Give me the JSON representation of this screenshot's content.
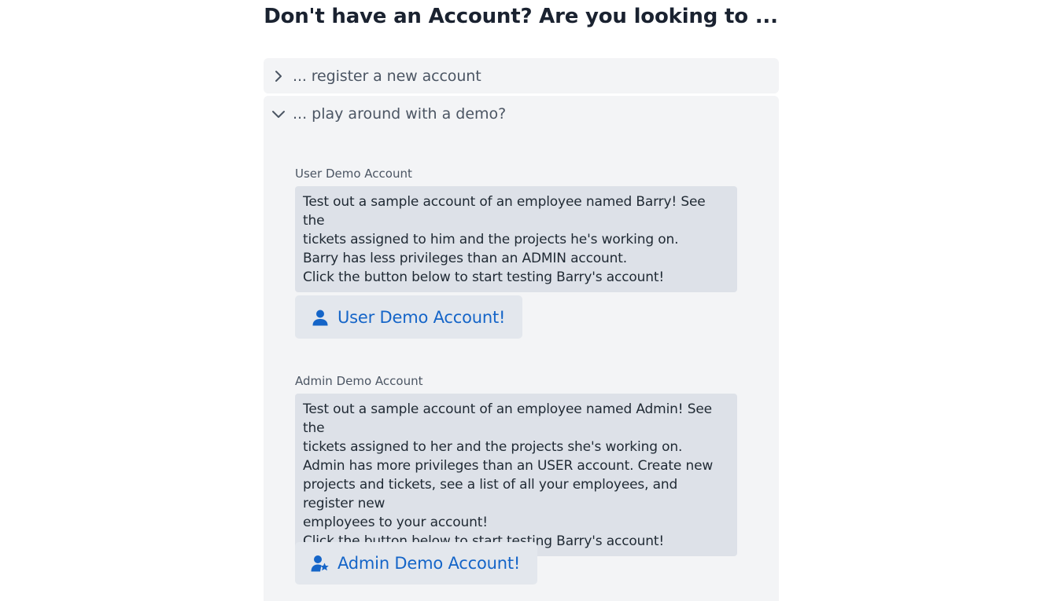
{
  "title": "Don't have an Account? Are you looking to ...",
  "accordion": {
    "register_label": "... register a new account",
    "demo_label": "... play around with a demo?"
  },
  "user_demo": {
    "label": "User Demo Account",
    "lines": [
      "Test out a sample account of an employee named Barry! See the",
      "tickets assigned to him and the projects he's working on.",
      "Barry has less privileges than an ADMIN account.",
      "Click the button below to start testing Barry's account!"
    ],
    "button_label": "User Demo Account!",
    "icon": "user-icon"
  },
  "admin_demo": {
    "label": "Admin Demo Account",
    "lines": [
      "Test out a sample account of an employee named Admin! See the",
      "tickets assigned to her and the projects she's working on.",
      "Admin has more privileges than an USER account. Create new",
      "projects and tickets, see a list of all your employees, and register new",
      "employees to your account!",
      "Click the button below to start testing Barry's account!"
    ],
    "button_label": "Admin Demo Account!",
    "icon": "user-star-icon"
  },
  "colors": {
    "accent": "#1565c8",
    "panel_bg": "#f3f4f6",
    "desc_bg": "#dde1e8",
    "button_bg": "#e3e7ed"
  }
}
